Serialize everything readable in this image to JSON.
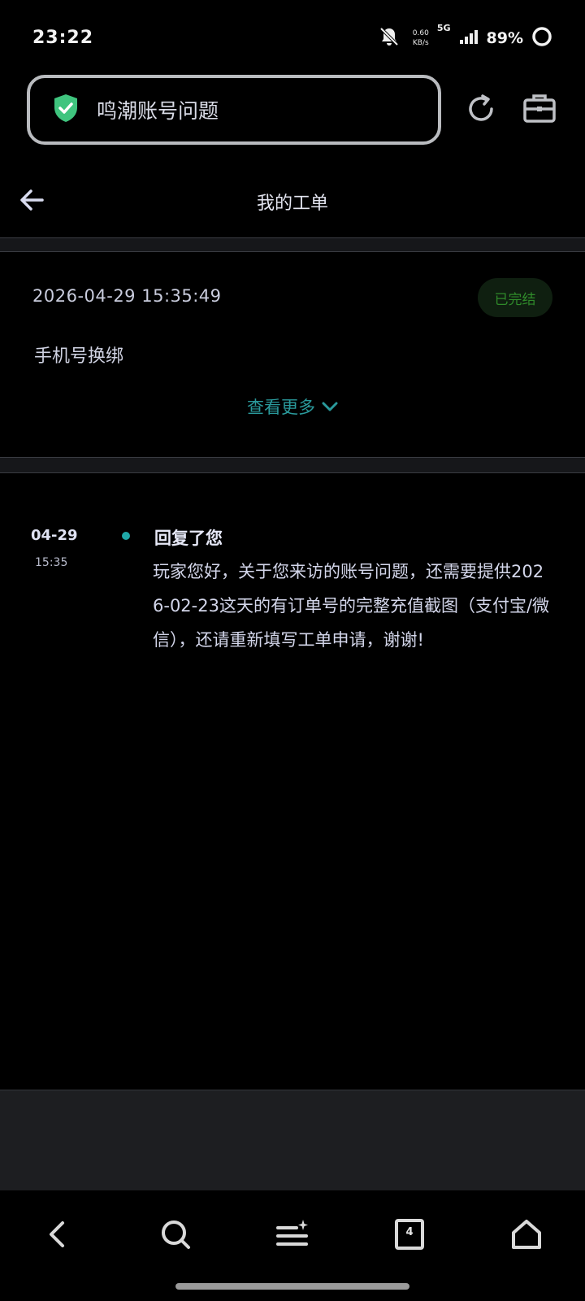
{
  "status_bar": {
    "time": "23:22",
    "net_speed_value": "0.60",
    "net_speed_unit": "KB/s",
    "network": "5G",
    "battery": "89%"
  },
  "browser": {
    "address_text": "鸣潮账号问题",
    "shield_color": "#3fc47e"
  },
  "header": {
    "title": "我的工单"
  },
  "ticket": {
    "date": "2026-04-29 15:35:49",
    "status": "已完结",
    "subject": "手机号换绑",
    "view_more": "查看更多"
  },
  "reply": {
    "date": "04-29",
    "time": "15:35",
    "title": "回复了您",
    "body": "玩家您好，关于您来访的账号问题，还需要提供2026-02-23这天的有订单号的完整充值截图（支付宝/微信），还请重新填写工单申请，谢谢!"
  },
  "nav": {
    "tab_count": "4"
  },
  "colors": {
    "accent": "#2a9a9c",
    "status_done": "#2f8a2a",
    "background": "#000000"
  }
}
